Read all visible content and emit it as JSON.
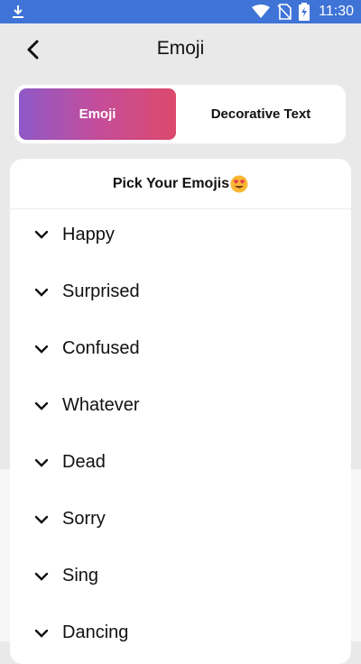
{
  "status_bar": {
    "time": "11:30",
    "icons": [
      "download-icon",
      "wifi-icon",
      "no-sim-icon",
      "battery-icon"
    ]
  },
  "app_bar": {
    "title": "Emoji",
    "back_icon": "chevron-left-icon"
  },
  "tabs": [
    {
      "label": "Emoji",
      "active": true
    },
    {
      "label": "Decorative Text",
      "active": false
    }
  ],
  "card": {
    "header": "Pick Your Emojis",
    "header_icon": "heart-eyes-emoji",
    "items": [
      {
        "label": "Happy"
      },
      {
        "label": "Surprised"
      },
      {
        "label": "Confused"
      },
      {
        "label": "Whatever"
      },
      {
        "label": "Dead"
      },
      {
        "label": "Sorry"
      },
      {
        "label": "Sing"
      },
      {
        "label": "Dancing"
      }
    ]
  },
  "colors": {
    "status_bar": "#3f74d6",
    "gradient_start": "#8e59c8",
    "gradient_end": "#dc4a6c",
    "background": "#e9e9e9"
  }
}
